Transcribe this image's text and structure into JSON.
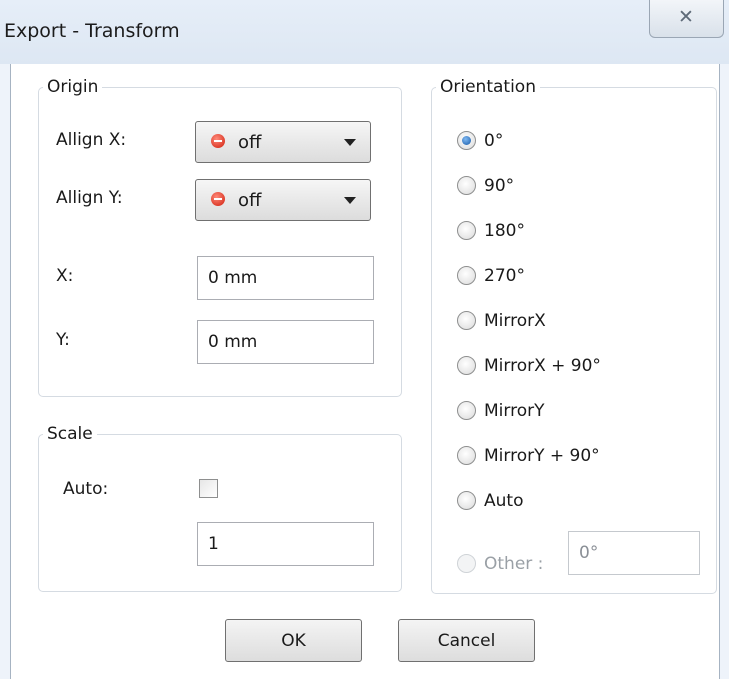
{
  "window": {
    "title": "Export - Transform",
    "close_glyph": "✕"
  },
  "origin": {
    "legend": "Origin",
    "allign_x_label": "Allign X:",
    "allign_x_value": "off",
    "allign_y_label": "Allign Y:",
    "allign_y_value": "off",
    "x_label": "X:",
    "x_value": "0 mm",
    "y_label": "Y:",
    "y_value": "0 mm"
  },
  "scale": {
    "legend": "Scale",
    "auto_label": "Auto:",
    "auto_checked": false,
    "value": "1"
  },
  "orientation": {
    "legend": "Orientation",
    "options": [
      {
        "label": "0°",
        "checked": true
      },
      {
        "label": "90°",
        "checked": false
      },
      {
        "label": "180°",
        "checked": false
      },
      {
        "label": "270°",
        "checked": false
      },
      {
        "label": "MirrorX",
        "checked": false
      },
      {
        "label": "MirrorX + 90°",
        "checked": false
      },
      {
        "label": "MirrorY",
        "checked": false
      },
      {
        "label": "MirrorY + 90°",
        "checked": false
      },
      {
        "label": "Auto",
        "checked": false
      }
    ],
    "other_label": "Other :",
    "other_value": "0°",
    "other_enabled": false
  },
  "buttons": {
    "ok": "OK",
    "cancel": "Cancel"
  },
  "icons": {
    "combo_status": "stop-icon",
    "combo_arrow": "chevron-down-icon"
  },
  "colors": {
    "stop_icon": "#d01e0c",
    "selected_radio": "#1659a8"
  }
}
